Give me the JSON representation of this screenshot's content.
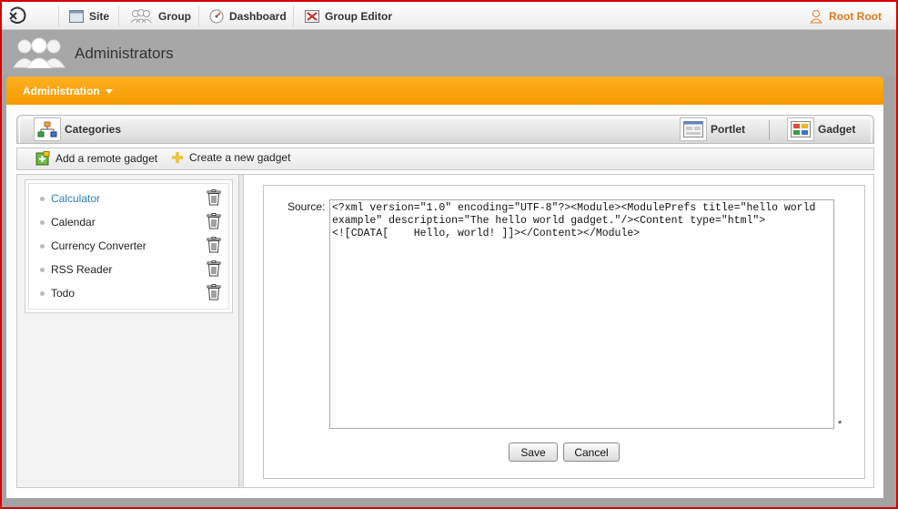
{
  "topbar": {
    "nav": [
      "Site",
      "Group",
      "Dashboard",
      "Group Editor"
    ],
    "user": "Root Root"
  },
  "page": {
    "title": "Administrators"
  },
  "menu": {
    "label": "Administration"
  },
  "tabs": {
    "categories": "Categories",
    "portlet": "Portlet",
    "gadget": "Gadget"
  },
  "actions": {
    "add_remote": "Add a remote gadget",
    "create_new": "Create a new gadget"
  },
  "gadgets": [
    {
      "label": "Calculator",
      "active": true
    },
    {
      "label": "Calendar",
      "active": false
    },
    {
      "label": "Currency Converter",
      "active": false
    },
    {
      "label": "RSS Reader",
      "active": false
    },
    {
      "label": "Todo",
      "active": false
    }
  ],
  "form": {
    "source_label": "Source:",
    "source_value": "<?xml version=\"1.0\" encoding=\"UTF-8\"?><Module><ModulePrefs title=\"hello world\nexample\" description=\"The hello world gadget.\"/><Content type=\"html\">\n<![CDATA[    Hello, world! ]]></Content></Module>",
    "required_mark": "*",
    "save_label": "Save",
    "cancel_label": "Cancel"
  },
  "colors": {
    "accent": "#f59a00",
    "link": "#2b7fc2",
    "user": "#e07a1c"
  }
}
